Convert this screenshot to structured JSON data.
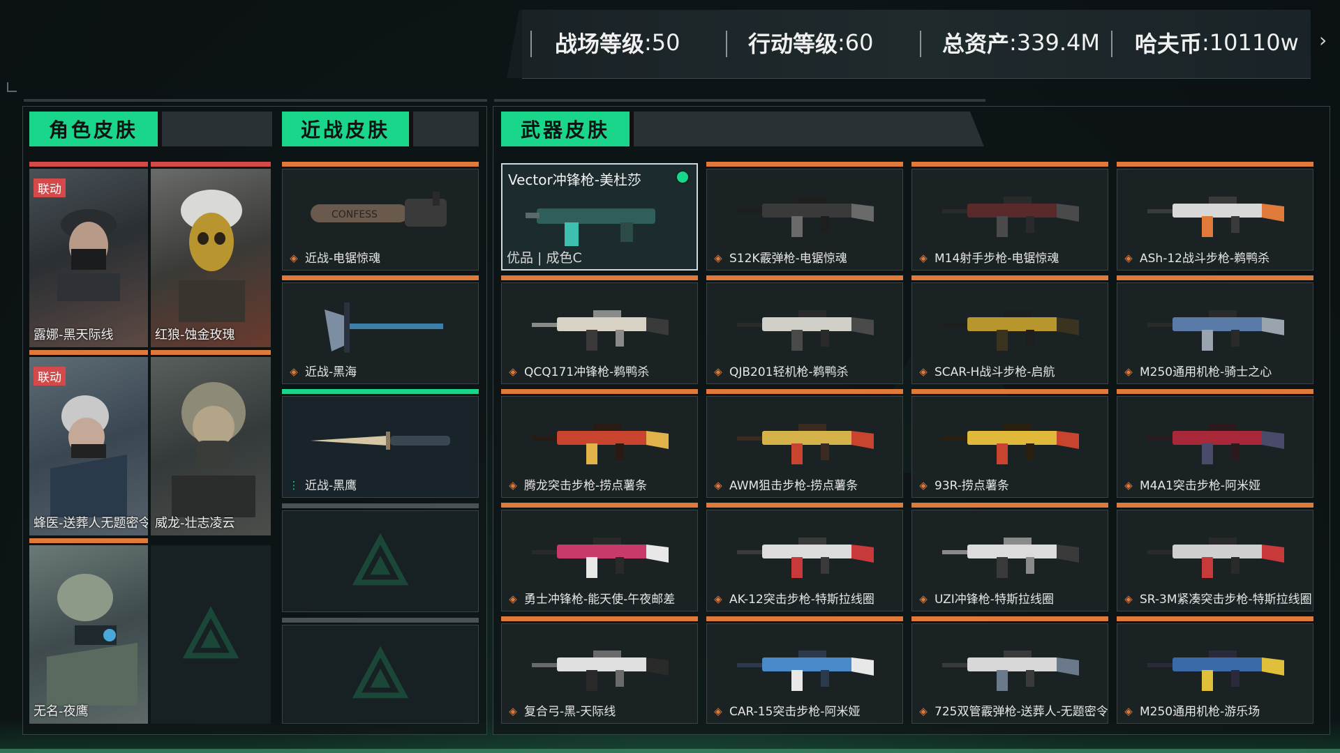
{
  "stats": {
    "battlefield_level": {
      "label": "战场等级",
      "value": ":50"
    },
    "operation_level": {
      "label": "行动等级",
      "value": ":60"
    },
    "total_assets": {
      "label": "总资产",
      "value": ":339.4M"
    },
    "hafu_coin": {
      "label": "哈夫币",
      "value": ":10110w"
    }
  },
  "tabs": {
    "character": "角色皮肤",
    "melee": "近战皮肤",
    "weapon": "武器皮肤"
  },
  "characters": [
    {
      "label": "露娜-黑天际线",
      "collab": "联动"
    },
    {
      "label": "红狼-蚀金玫瑰",
      "collab": ""
    },
    {
      "label": "蜂医-送葬人无题密令",
      "collab": "联动"
    },
    {
      "label": "威龙-壮志凌云",
      "collab": ""
    },
    {
      "label": "无名-夜鹰",
      "collab": ""
    }
  ],
  "melee": [
    {
      "label": "近战-电锯惊魂"
    },
    {
      "label": "近战-黑海"
    },
    {
      "label": "近战-黑鹰"
    }
  ],
  "selected_weapon": {
    "name": "Vector冲锋枪-美杜莎",
    "grade": "优品 | 成色C"
  },
  "weapons": [
    {
      "label": "S12K霰弹枪-电锯惊魂"
    },
    {
      "label": "M14射手步枪-电锯惊魂"
    },
    {
      "label": "ASh-12战斗步枪-鹈鸭杀"
    },
    {
      "label": "QCQ171冲锋枪-鹈鸭杀"
    },
    {
      "label": "QJB201轻机枪-鹈鸭杀"
    },
    {
      "label": "SCAR-H战斗步枪-启航"
    },
    {
      "label": "M250通用机枪-骑士之心"
    },
    {
      "label": "腾龙突击步枪-捞点薯条"
    },
    {
      "label": "AWM狙击步枪-捞点薯条"
    },
    {
      "label": "93R-捞点薯条"
    },
    {
      "label": "M4A1突击步枪-阿米娅"
    },
    {
      "label": "勇士冲锋枪-能天使-午夜邮差"
    },
    {
      "label": "AK-12突击步枪-特斯拉线圈"
    },
    {
      "label": "UZI冲锋枪-特斯拉线圈"
    },
    {
      "label": "SR-3M紧凑突击步枪-特斯拉线圈"
    },
    {
      "label": "复合弓-黑-天际线"
    },
    {
      "label": "CAR-15突击步枪-阿米娅"
    },
    {
      "label": "725双管霰弹枪-送葬人-无题密令"
    },
    {
      "label": "M250通用机枪-游乐场"
    }
  ],
  "colors": {
    "accent": "#19d68a",
    "orange": "#e07a3a",
    "collab_red": "#d44a4a"
  }
}
